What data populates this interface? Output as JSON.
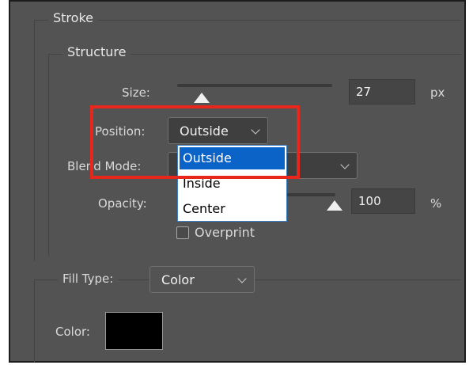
{
  "panel": {
    "stroke_legend": "Stroke",
    "structure_legend": "Structure"
  },
  "size": {
    "label": "Size:",
    "value": "27",
    "unit": "px",
    "level": 0.16
  },
  "position": {
    "label": "Position:",
    "selected": "Outside",
    "options": [
      "Outside",
      "Inside",
      "Center"
    ]
  },
  "blend_mode": {
    "label": "Blend Mode:"
  },
  "opacity": {
    "label": "Opacity:",
    "value": "100",
    "unit": "%",
    "level": 1.0
  },
  "overprint": {
    "label": "Overprint",
    "checked": false
  },
  "fill_type": {
    "label": "Fill Type:",
    "selected": "Color"
  },
  "color": {
    "label": "Color:",
    "swatch": "#000000"
  },
  "colors": {
    "panel_bg": "#535353",
    "highlight": "#e8271c",
    "selection": "#0b63c7"
  }
}
